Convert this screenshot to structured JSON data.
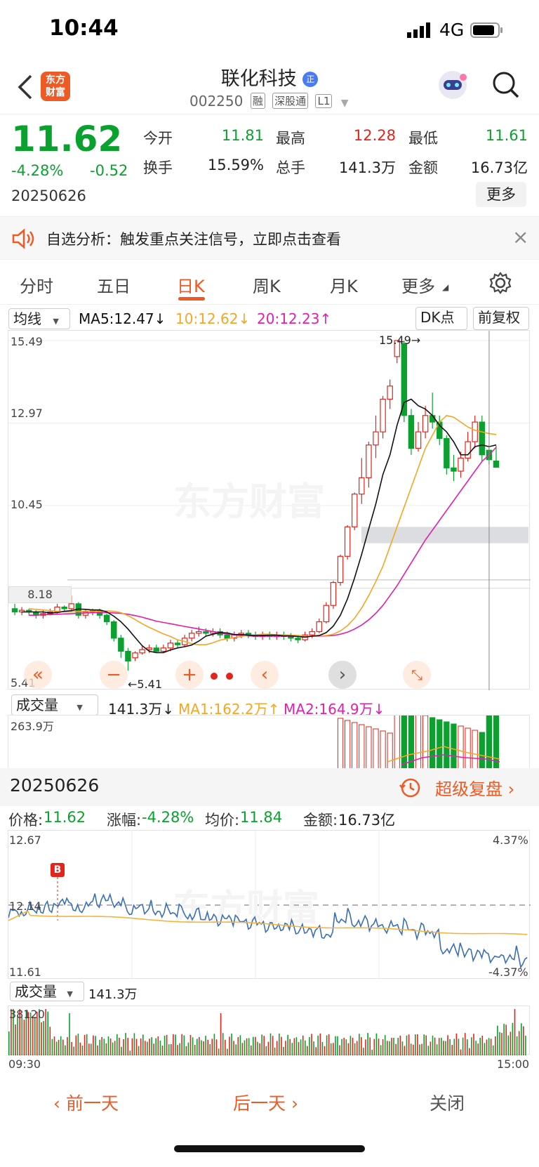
{
  "status_bar": {
    "time": "10:44",
    "network": "4G"
  },
  "header": {
    "logo_text_1": "东方",
    "logo_text_2": "财富",
    "stock_name": "联化科技",
    "badge": "正",
    "stock_code": "002250",
    "tags": [
      "融",
      "深股通",
      "L1"
    ]
  },
  "quote": {
    "price": "11.62",
    "change_pct": "-4.28%",
    "change": "-0.52",
    "date": "20250626",
    "open_label": "今开",
    "open": "11.81",
    "high_label": "最高",
    "high": "12.28",
    "low_label": "最低",
    "low": "11.61",
    "turnover_label": "换手",
    "turnover": "15.59%",
    "volume_label": "总手",
    "volume": "141.3万",
    "amount_label": "金额",
    "amount": "16.73亿",
    "more_label": "更多"
  },
  "banner": {
    "text": "自选分析：触发重点关注信号，立即点击查看",
    "close_icon": "×"
  },
  "tabs": [
    "分时",
    "五日",
    "日K",
    "周K",
    "月K",
    "更多"
  ],
  "active_tab": "日K",
  "kline_toolbar": {
    "ma_select": "均线",
    "ma5": "MA5:12.47↓",
    "ma10": "10:12.62↓",
    "ma20": "20:12.23↑",
    "dk_label": "DK点",
    "adjust_label": "前复权"
  },
  "kline_axis": {
    "y_labels": [
      "15.49",
      "12.97",
      "10.45",
      "8.18",
      "5.41"
    ],
    "high_marker": "15.49→",
    "low_marker": "←5.41"
  },
  "volume_toolbar": {
    "select": "成交量",
    "vol": "141.3万↓",
    "ma1": "MA1:162.2万↑",
    "ma2": "MA2:164.9万↓",
    "max_label": "263.9万"
  },
  "replay": {
    "date": "20250626",
    "label": "超级复盘 ›"
  },
  "info_row": {
    "price_label": "价格:",
    "price": "11.62",
    "change_label": "涨幅:",
    "change": "-4.28%",
    "avg_label": "均价:",
    "avg": "11.84",
    "amount_label": "金额:",
    "amount": "16.73亿"
  },
  "intraday": {
    "top_left": "12.67",
    "top_right": "4.37%",
    "mid": "12.14",
    "bottom_left": "11.61",
    "bottom_right": "-4.37%",
    "buy_marker": "B",
    "vol_select": "成交量",
    "vol_value": "141.3万",
    "vol_max": "38120",
    "time_start": "09:30",
    "time_end": "15:00"
  },
  "colors": {
    "up": "#e4241b",
    "down": "#0ba12f",
    "accent": "#ee5a24",
    "ma5": "#111111",
    "ma10": "#f5a623",
    "ma20": "#e020b0"
  },
  "chart_data": {
    "type": "candlestick",
    "title": "联化科技 日K",
    "ylim": [
      5.41,
      15.49
    ],
    "candles": [
      {
        "o": 7.3,
        "c": 7.2,
        "h": 7.45,
        "l": 7.1
      },
      {
        "o": 7.2,
        "c": 7.25,
        "h": 7.35,
        "l": 7.1
      },
      {
        "o": 7.25,
        "c": 7.2,
        "h": 7.3,
        "l": 7.1
      },
      {
        "o": 7.2,
        "c": 7.1,
        "h": 7.25,
        "l": 7.0
      },
      {
        "o": 7.1,
        "c": 7.15,
        "h": 7.25,
        "l": 7.0
      },
      {
        "o": 7.15,
        "c": 7.2,
        "h": 7.3,
        "l": 7.1
      },
      {
        "o": 7.2,
        "c": 7.35,
        "h": 7.45,
        "l": 7.15
      },
      {
        "o": 7.35,
        "c": 7.3,
        "h": 7.4,
        "l": 7.2
      },
      {
        "o": 7.3,
        "c": 7.45,
        "h": 7.7,
        "l": 7.25
      },
      {
        "o": 7.45,
        "c": 7.1,
        "h": 7.5,
        "l": 7.0
      },
      {
        "o": 7.1,
        "c": 7.2,
        "h": 7.3,
        "l": 7.0
      },
      {
        "o": 7.2,
        "c": 7.25,
        "h": 7.3,
        "l": 7.1
      },
      {
        "o": 7.25,
        "c": 7.1,
        "h": 7.3,
        "l": 7.0
      },
      {
        "o": 7.1,
        "c": 6.9,
        "h": 7.15,
        "l": 6.8
      },
      {
        "o": 6.9,
        "c": 6.4,
        "h": 6.95,
        "l": 6.3
      },
      {
        "o": 6.4,
        "c": 6.0,
        "h": 6.5,
        "l": 5.8
      },
      {
        "o": 6.0,
        "c": 5.7,
        "h": 6.1,
        "l": 5.41
      },
      {
        "o": 5.8,
        "c": 5.95,
        "h": 6.0,
        "l": 5.7
      },
      {
        "o": 5.95,
        "c": 6.05,
        "h": 6.15,
        "l": 5.9
      },
      {
        "o": 6.05,
        "c": 6.1,
        "h": 6.2,
        "l": 5.95
      },
      {
        "o": 6.1,
        "c": 6.0,
        "h": 6.2,
        "l": 5.95
      },
      {
        "o": 6.0,
        "c": 6.1,
        "h": 6.2,
        "l": 5.95
      },
      {
        "o": 6.1,
        "c": 6.25,
        "h": 6.35,
        "l": 6.0
      },
      {
        "o": 6.25,
        "c": 6.2,
        "h": 6.35,
        "l": 6.1
      },
      {
        "o": 6.2,
        "c": 6.4,
        "h": 6.5,
        "l": 6.15
      },
      {
        "o": 6.4,
        "c": 6.55,
        "h": 6.65,
        "l": 6.3
      },
      {
        "o": 6.55,
        "c": 6.6,
        "h": 6.75,
        "l": 6.45
      },
      {
        "o": 6.6,
        "c": 6.55,
        "h": 6.7,
        "l": 6.45
      },
      {
        "o": 6.55,
        "c": 6.6,
        "h": 6.7,
        "l": 6.45
      },
      {
        "o": 6.6,
        "c": 6.5,
        "h": 6.7,
        "l": 6.4
      },
      {
        "o": 6.5,
        "c": 6.4,
        "h": 6.6,
        "l": 6.3
      },
      {
        "o": 6.4,
        "c": 6.5,
        "h": 6.6,
        "l": 6.3
      },
      {
        "o": 6.5,
        "c": 6.55,
        "h": 6.65,
        "l": 6.4
      },
      {
        "o": 6.55,
        "c": 6.5,
        "h": 6.65,
        "l": 6.4
      },
      {
        "o": 6.5,
        "c": 6.45,
        "h": 6.6,
        "l": 6.35
      },
      {
        "o": 6.45,
        "c": 6.5,
        "h": 6.6,
        "l": 6.35
      },
      {
        "o": 6.5,
        "c": 6.45,
        "h": 6.6,
        "l": 6.35
      },
      {
        "o": 6.45,
        "c": 6.5,
        "h": 6.6,
        "l": 6.35
      },
      {
        "o": 6.5,
        "c": 6.45,
        "h": 6.6,
        "l": 6.35
      },
      {
        "o": 6.45,
        "c": 6.4,
        "h": 6.55,
        "l": 6.3
      },
      {
        "o": 6.4,
        "c": 6.35,
        "h": 6.5,
        "l": 6.25
      },
      {
        "o": 6.35,
        "c": 6.5,
        "h": 6.6,
        "l": 6.3
      },
      {
        "o": 6.5,
        "c": 6.6,
        "h": 6.7,
        "l": 6.4
      },
      {
        "o": 6.6,
        "c": 6.9,
        "h": 7.0,
        "l": 6.55
      },
      {
        "o": 6.9,
        "c": 7.4,
        "h": 7.5,
        "l": 6.85
      },
      {
        "o": 7.4,
        "c": 8.1,
        "h": 8.15,
        "l": 7.3
      },
      {
        "o": 8.1,
        "c": 8.9,
        "h": 8.95,
        "l": 8.0
      },
      {
        "o": 8.9,
        "c": 9.8,
        "h": 9.85,
        "l": 8.8
      },
      {
        "o": 9.8,
        "c": 10.8,
        "h": 10.85,
        "l": 9.7
      },
      {
        "o": 10.8,
        "c": 11.3,
        "h": 11.9,
        "l": 10.5
      },
      {
        "o": 11.3,
        "c": 12.3,
        "h": 12.4,
        "l": 11.0
      },
      {
        "o": 12.3,
        "c": 12.7,
        "h": 13.2,
        "l": 11.9
      },
      {
        "o": 12.7,
        "c": 13.7,
        "h": 13.8,
        "l": 12.5
      },
      {
        "o": 13.7,
        "c": 14.1,
        "h": 14.3,
        "l": 13.4
      },
      {
        "o": 15.0,
        "c": 15.49,
        "h": 15.49,
        "l": 14.8
      },
      {
        "o": 15.4,
        "c": 13.2,
        "h": 15.49,
        "l": 13.0
      },
      {
        "o": 13.2,
        "c": 12.2,
        "h": 13.4,
        "l": 12.0
      },
      {
        "o": 12.2,
        "c": 12.7,
        "h": 13.0,
        "l": 12.1
      },
      {
        "o": 12.7,
        "c": 13.2,
        "h": 13.5,
        "l": 12.5
      },
      {
        "o": 13.2,
        "c": 13.0,
        "h": 13.9,
        "l": 12.8
      },
      {
        "o": 13.0,
        "c": 12.5,
        "h": 13.2,
        "l": 12.3
      },
      {
        "o": 12.5,
        "c": 11.6,
        "h": 12.6,
        "l": 11.4
      },
      {
        "o": 11.6,
        "c": 11.5,
        "h": 12.0,
        "l": 11.2
      },
      {
        "o": 11.5,
        "c": 11.9,
        "h": 12.1,
        "l": 11.3
      },
      {
        "o": 11.9,
        "c": 12.4,
        "h": 12.7,
        "l": 11.8
      },
      {
        "o": 12.4,
        "c": 13.0,
        "h": 13.2,
        "l": 12.2
      },
      {
        "o": 13.0,
        "c": 12.0,
        "h": 13.2,
        "l": 11.8
      },
      {
        "o": 12.14,
        "c": 11.85,
        "h": 12.3,
        "l": 11.7
      },
      {
        "o": 11.81,
        "c": 11.62,
        "h": 12.28,
        "l": 11.61
      }
    ],
    "ma5": [
      7.2,
      7.2,
      7.2,
      7.2,
      7.17,
      7.18,
      7.22,
      7.24,
      7.29,
      7.28,
      7.26,
      7.26,
      7.2,
      7.07,
      6.9,
      6.68,
      6.42,
      6.17,
      6.0,
      5.96,
      5.96,
      6.04,
      6.1,
      6.14,
      6.19,
      6.31,
      6.46,
      6.52,
      6.57,
      6.56,
      6.51,
      6.51,
      6.49,
      6.48,
      6.48,
      6.49,
      6.49,
      6.47,
      6.47,
      6.45,
      6.43,
      6.46,
      6.48,
      6.57,
      6.77,
      7.1,
      7.6,
      8.24,
      8.96,
      9.74,
      10.5,
      11.4,
      12.0,
      12.9,
      13.6,
      13.7,
      13.5,
      13.4,
      13.2,
      12.9,
      12.7,
      12.4,
      12.0,
      12.0,
      12.25,
      12.3,
      12.25,
      12.3
    ],
    "ma10": [
      7.3,
      7.28,
      7.26,
      7.24,
      7.22,
      7.2,
      7.2,
      7.21,
      7.22,
      7.22,
      7.22,
      7.23,
      7.22,
      7.18,
      7.09,
      6.97,
      6.84,
      6.73,
      6.63,
      6.53,
      6.45,
      6.35,
      6.3,
      6.23,
      6.2,
      6.2,
      6.26,
      6.34,
      6.38,
      6.42,
      6.45,
      6.49,
      6.5,
      6.52,
      6.52,
      6.5,
      6.5,
      6.49,
      6.48,
      6.47,
      6.46,
      6.47,
      6.48,
      6.52,
      6.62,
      6.78,
      7.01,
      7.32,
      7.7,
      8.13,
      8.6,
      9.2,
      9.8,
      10.4,
      11.0,
      11.6,
      12.2,
      12.6,
      13.0,
      13.2,
      13.15,
      13.0,
      12.85,
      12.75,
      12.7,
      12.65,
      12.62
    ],
    "ma20": [
      7.1,
      7.1,
      7.12,
      7.12,
      7.13,
      7.14,
      7.15,
      7.16,
      7.17,
      7.18,
      7.18,
      7.18,
      7.17,
      7.16,
      7.13,
      7.09,
      7.04,
      6.98,
      6.92,
      6.88,
      6.84,
      6.8,
      6.76,
      6.72,
      6.68,
      6.64,
      6.6,
      6.56,
      6.53,
      6.5,
      6.48,
      6.47,
      6.46,
      6.46,
      6.46,
      6.46,
      6.46,
      6.46,
      6.46,
      6.46,
      6.46,
      6.46,
      6.47,
      6.48,
      6.52,
      6.58,
      6.68,
      6.8,
      6.96,
      7.16,
      7.4,
      7.7,
      8.0,
      8.35,
      8.7,
      9.05,
      9.4,
      9.7,
      10.0,
      10.3,
      10.6,
      10.9,
      11.2,
      11.5,
      11.8,
      12.0,
      12.23
    ],
    "support_line": 8.18
  }
}
